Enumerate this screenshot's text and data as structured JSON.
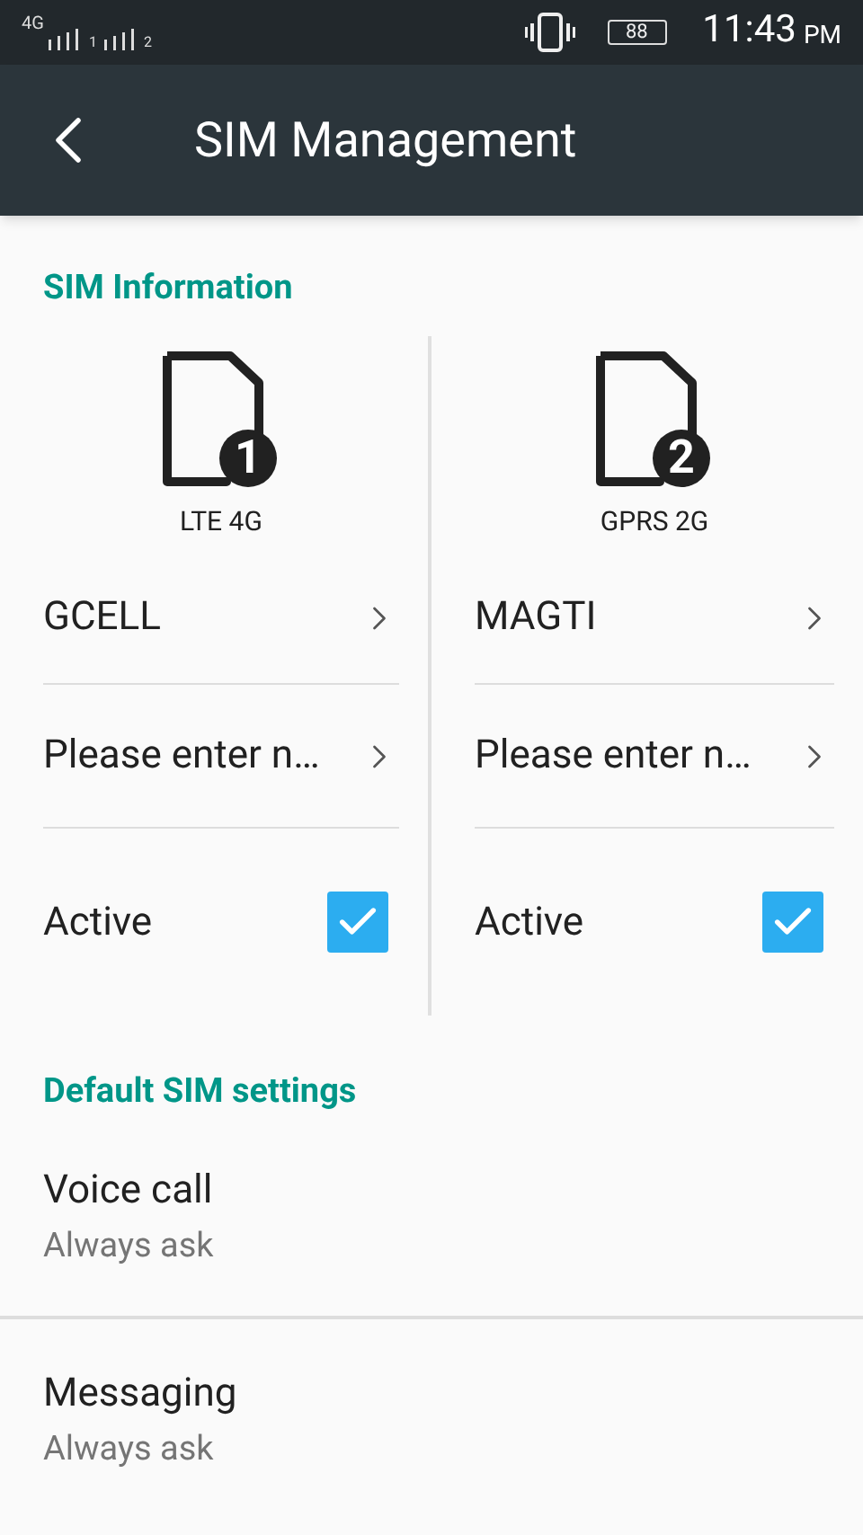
{
  "status_bar": {
    "network": "4G",
    "sim_slots": [
      "1",
      "2"
    ],
    "battery": "88",
    "time": "11:43",
    "ampm": "PM"
  },
  "toolbar": {
    "title": "SIM Management"
  },
  "sim_information": {
    "header": "SIM Information",
    "sims": [
      {
        "badge": "1",
        "network_type": "LTE 4G",
        "operator": "GCELL",
        "number_placeholder": "Please enter n…",
        "active_label": "Active",
        "active": true
      },
      {
        "badge": "2",
        "network_type": "GPRS 2G",
        "operator": "MAGTI",
        "number_placeholder": "Please enter n…",
        "active_label": "Active",
        "active": true
      }
    ]
  },
  "default_sim_settings": {
    "header": "Default SIM settings",
    "items": [
      {
        "title": "Voice call",
        "value": "Always ask"
      },
      {
        "title": "Messaging",
        "value": "Always ask"
      }
    ]
  }
}
